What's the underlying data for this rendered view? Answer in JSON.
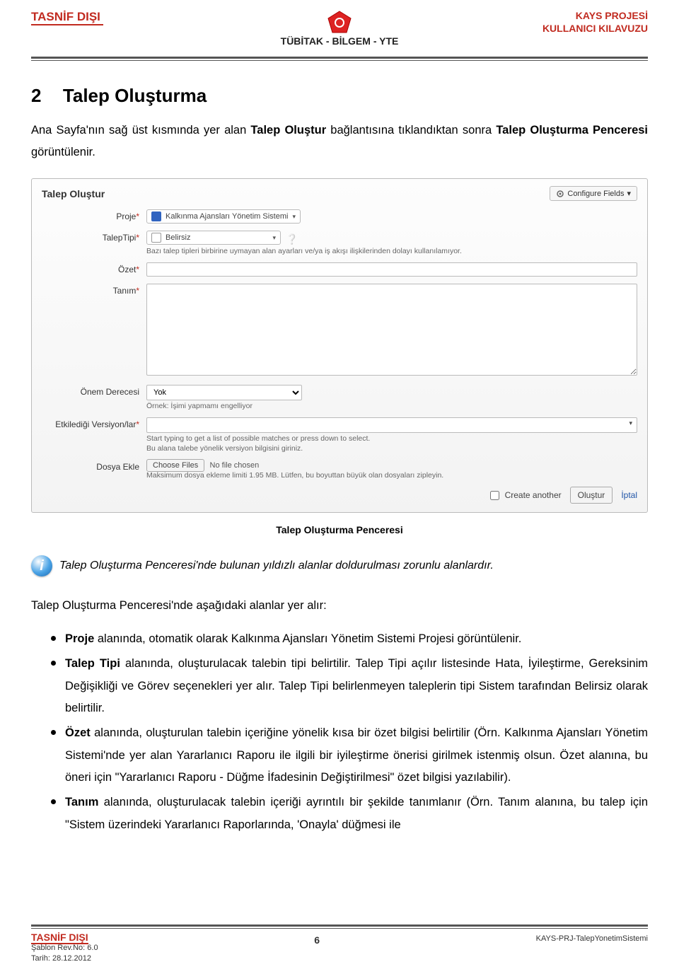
{
  "header": {
    "left": "TASNİF DIŞI",
    "right1": "KAYS PROJESİ",
    "right2": "KULLANICI KILAVUZU",
    "sub": "TÜBİTAK - BİLGEM - YTE"
  },
  "section": {
    "num": "2",
    "title": "Talep Oluşturma"
  },
  "intro": {
    "t1": "Ana Sayfa'nın sağ üst kısmında yer alan ",
    "b1": "Talep Oluştur",
    "t2": " bağlantısına tıklandıktan sonra ",
    "b2": "Talep Oluşturma Penceresi",
    "t3": " görüntülenir."
  },
  "form": {
    "title": "Talep Oluştur",
    "configure": "Configure Fields",
    "labels": {
      "proje": "Proje",
      "tip": "TalepTipi",
      "ozet": "Özet",
      "tanim": "Tanım",
      "onem": "Önem Derecesi",
      "versiyon": "Etkilediği Versiyon/lar",
      "dosya": "Dosya Ekle"
    },
    "values": {
      "proje": "Kalkınma Ajansları Yönetim Sistemi",
      "tip": "Belirsiz",
      "onem": "Yok"
    },
    "hints": {
      "tip": "Bazı talep tipleri birbirine uymayan alan ayarları ve/ya iş akışı ilişkilerinden dolayı kullanılamıyor.",
      "onem": "Örnek: İşimi yapmamı engelliyor",
      "ver1": "Start typing to get a list of possible matches or press down to select.",
      "ver2": "Bu alana talebe yönelik versiyon bilgisini giriniz.",
      "dosya": "Maksimum dosya ekleme limiti 1.95 MB. Lütfen, bu boyuttan büyük olan dosyaları zipleyin.",
      "dosya_btn": "Choose Files",
      "dosya_none": "No file chosen"
    },
    "footer": {
      "create_another": "Create another",
      "olustur": "Oluştur",
      "iptal": "İptal"
    }
  },
  "caption": "Talep Oluşturma Penceresi",
  "info": "Talep Oluşturma Penceresi'nde bulunan yıldızlı alanlar doldurulması zorunlu alanlardır.",
  "list_intro": "Talep Oluşturma Penceresi'nde aşağıdaki alanlar yer alır:",
  "bullets": {
    "b1a": "Proje",
    "b1b": " alanında, otomatik olarak Kalkınma Ajansları Yönetim Sistemi Projesi görüntülenir.",
    "b2a": "Talep Tipi",
    "b2b": " alanında, oluşturulacak talebin tipi belirtilir. Talep Tipi açılır listesinde Hata, İyileştirme, Gereksinim Değişikliği ve Görev seçenekleri yer alır. Talep Tipi belirlenmeyen taleplerin tipi Sistem tarafından Belirsiz olarak belirtilir.",
    "b3a": "Özet",
    "b3b": " alanında, oluşturulan talebin içeriğine yönelik kısa bir özet bilgisi belirtilir (Örn. Kalkınma Ajansları Yönetim Sistemi'nde yer alan Yararlanıcı Raporu ile ilgili bir iyileştirme önerisi girilmek istenmiş olsun. Özet alanına, bu öneri için \"Yararlanıcı Raporu - Düğme İfadesinin Değiştirilmesi\" özet bilgisi yazılabilir).",
    "b4a": "Tanım",
    "b4b": " alanında, oluşturulacak talebin içeriği ayrıntılı bir şekilde tanımlanır (Örn. Tanım alanına, bu talep için \"Sistem üzerindeki Yararlanıcı Raporlarında, 'Onayla' düğmesi ile"
  },
  "footer": {
    "left1": "TASNİF DIŞI",
    "left2": "Şablon Rev.No: 6.0",
    "left3": "Tarih: 28.12.2012",
    "center": "6",
    "right": "KAYS-PRJ-TalepYonetimSistemi"
  }
}
